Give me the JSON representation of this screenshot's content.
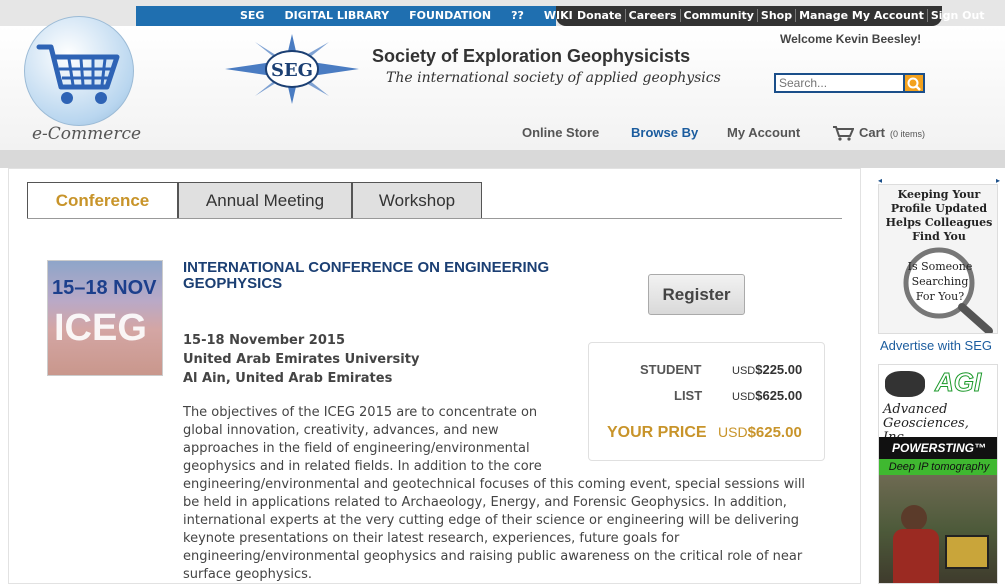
{
  "top_nav": {
    "left_links": [
      "SEG",
      "DIGITAL LIBRARY",
      "FOUNDATION",
      "??",
      "WIKI"
    ],
    "right_links": [
      "Donate",
      "Careers",
      "Community",
      "Shop",
      "Manage My Account",
      "Sign Out"
    ]
  },
  "header": {
    "store_label": "e-Commerce",
    "seg_logo_text": "SEG",
    "org_name": "Society of Exploration Geophysicists",
    "org_tagline": "The international society of applied geophysics",
    "welcome": "Welcome Kevin Beesley!",
    "search_placeholder": "Search..."
  },
  "main_nav": {
    "online_store": "Online Store",
    "browse_by": "Browse By",
    "my_account": "My Account",
    "cart": "Cart",
    "cart_count": "(0 items)"
  },
  "tabs": [
    "Conference",
    "Annual Meeting",
    "Workshop"
  ],
  "event": {
    "thumb_line1": "15–18 NOV",
    "thumb_line2": "ICEG",
    "title": "INTERNATIONAL CONFERENCE ON ENGINEERING GEOPHYSICS",
    "register": "Register",
    "date": "15-18 November 2015",
    "venue": "United Arab Emirates University",
    "location": "Al Ain, United Arab Emirates",
    "description": "The objectives of the ICEG 2015 are to concentrate on global innovation, creativity, advances, and new approaches in the field of engineering/environmental geophysics and in related fields. In addition to the core engineering/environmental and geotechnical focuses of this coming event, special sessions will be held in applications related to Archaeology, Energy, and Forensic Geophysics. In addition, international experts at the very cutting edge of their science or engineering will be delivering keynote presentations on their latest research, experiences, future goals for engineering/environmental geophysics and raising public awareness on the critical role of near surface geophysics."
  },
  "pricing": {
    "student_label": "STUDENT",
    "student_currency": "USD",
    "student_price": "$225.00",
    "list_label": "LIST",
    "list_currency": "USD",
    "list_price": "$625.00",
    "your_price_label": "YOUR PRICE",
    "your_currency": "USD",
    "your_price": "$625.00"
  },
  "sidebar": {
    "ad1_text": "Keeping Your Profile Updated Helps Colleagues Find You",
    "ad1_bubble": "Is Someone Searching For You?",
    "advertise": "Advertise with SEG",
    "ad2_brand": "AGI",
    "ad2_company": "Advanced Geosciences, Inc.",
    "ad2_product": "POWERSTING™",
    "ad2_sub": "Deep IP tomography"
  },
  "colors": {
    "accent_gold": "#c8942a",
    "title_blue": "#1b3f73",
    "top_blue": "#1f6fb0"
  }
}
